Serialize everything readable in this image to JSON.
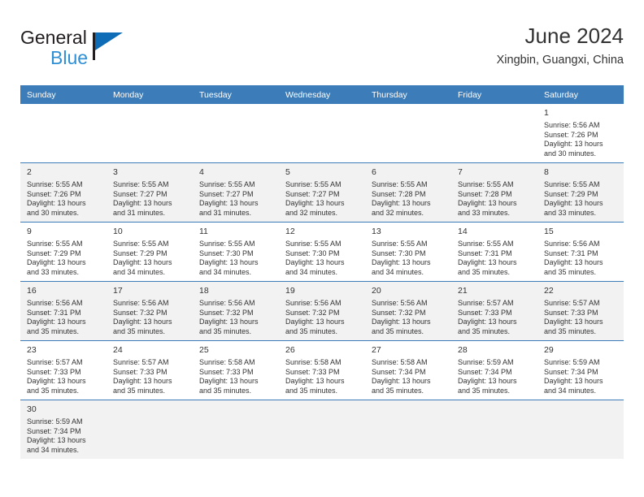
{
  "brand": {
    "name_line1": "General",
    "name_line2": "Blue",
    "primary_color": "#0f6cb6",
    "accent_color": "#2f8fd4"
  },
  "header": {
    "title": "June 2024",
    "subtitle": "Xingbin, Guangxi, China"
  },
  "calendar": {
    "header_bg": "#3b7cb9",
    "weekday_headers": [
      "Sunday",
      "Monday",
      "Tuesday",
      "Wednesday",
      "Thursday",
      "Friday",
      "Saturday"
    ],
    "labels": {
      "sunrise": "Sunrise:",
      "sunset": "Sunset:",
      "daylight": "Daylight:"
    },
    "weeks": [
      [
        {
          "day": ""
        },
        {
          "day": ""
        },
        {
          "day": ""
        },
        {
          "day": ""
        },
        {
          "day": ""
        },
        {
          "day": ""
        },
        {
          "day": "1",
          "sunrise": "Sunrise: 5:56 AM",
          "sunset": "Sunset: 7:26 PM",
          "daylight_line1": "Daylight: 13 hours",
          "daylight_line2": "and 30 minutes."
        }
      ],
      [
        {
          "day": "2",
          "sunrise": "Sunrise: 5:55 AM",
          "sunset": "Sunset: 7:26 PM",
          "daylight_line1": "Daylight: 13 hours",
          "daylight_line2": "and 30 minutes."
        },
        {
          "day": "3",
          "sunrise": "Sunrise: 5:55 AM",
          "sunset": "Sunset: 7:27 PM",
          "daylight_line1": "Daylight: 13 hours",
          "daylight_line2": "and 31 minutes."
        },
        {
          "day": "4",
          "sunrise": "Sunrise: 5:55 AM",
          "sunset": "Sunset: 7:27 PM",
          "daylight_line1": "Daylight: 13 hours",
          "daylight_line2": "and 31 minutes."
        },
        {
          "day": "5",
          "sunrise": "Sunrise: 5:55 AM",
          "sunset": "Sunset: 7:27 PM",
          "daylight_line1": "Daylight: 13 hours",
          "daylight_line2": "and 32 minutes."
        },
        {
          "day": "6",
          "sunrise": "Sunrise: 5:55 AM",
          "sunset": "Sunset: 7:28 PM",
          "daylight_line1": "Daylight: 13 hours",
          "daylight_line2": "and 32 minutes."
        },
        {
          "day": "7",
          "sunrise": "Sunrise: 5:55 AM",
          "sunset": "Sunset: 7:28 PM",
          "daylight_line1": "Daylight: 13 hours",
          "daylight_line2": "and 33 minutes."
        },
        {
          "day": "8",
          "sunrise": "Sunrise: 5:55 AM",
          "sunset": "Sunset: 7:29 PM",
          "daylight_line1": "Daylight: 13 hours",
          "daylight_line2": "and 33 minutes."
        }
      ],
      [
        {
          "day": "9",
          "sunrise": "Sunrise: 5:55 AM",
          "sunset": "Sunset: 7:29 PM",
          "daylight_line1": "Daylight: 13 hours",
          "daylight_line2": "and 33 minutes."
        },
        {
          "day": "10",
          "sunrise": "Sunrise: 5:55 AM",
          "sunset": "Sunset: 7:29 PM",
          "daylight_line1": "Daylight: 13 hours",
          "daylight_line2": "and 34 minutes."
        },
        {
          "day": "11",
          "sunrise": "Sunrise: 5:55 AM",
          "sunset": "Sunset: 7:30 PM",
          "daylight_line1": "Daylight: 13 hours",
          "daylight_line2": "and 34 minutes."
        },
        {
          "day": "12",
          "sunrise": "Sunrise: 5:55 AM",
          "sunset": "Sunset: 7:30 PM",
          "daylight_line1": "Daylight: 13 hours",
          "daylight_line2": "and 34 minutes."
        },
        {
          "day": "13",
          "sunrise": "Sunrise: 5:55 AM",
          "sunset": "Sunset: 7:30 PM",
          "daylight_line1": "Daylight: 13 hours",
          "daylight_line2": "and 34 minutes."
        },
        {
          "day": "14",
          "sunrise": "Sunrise: 5:55 AM",
          "sunset": "Sunset: 7:31 PM",
          "daylight_line1": "Daylight: 13 hours",
          "daylight_line2": "and 35 minutes."
        },
        {
          "day": "15",
          "sunrise": "Sunrise: 5:56 AM",
          "sunset": "Sunset: 7:31 PM",
          "daylight_line1": "Daylight: 13 hours",
          "daylight_line2": "and 35 minutes."
        }
      ],
      [
        {
          "day": "16",
          "sunrise": "Sunrise: 5:56 AM",
          "sunset": "Sunset: 7:31 PM",
          "daylight_line1": "Daylight: 13 hours",
          "daylight_line2": "and 35 minutes."
        },
        {
          "day": "17",
          "sunrise": "Sunrise: 5:56 AM",
          "sunset": "Sunset: 7:32 PM",
          "daylight_line1": "Daylight: 13 hours",
          "daylight_line2": "and 35 minutes."
        },
        {
          "day": "18",
          "sunrise": "Sunrise: 5:56 AM",
          "sunset": "Sunset: 7:32 PM",
          "daylight_line1": "Daylight: 13 hours",
          "daylight_line2": "and 35 minutes."
        },
        {
          "day": "19",
          "sunrise": "Sunrise: 5:56 AM",
          "sunset": "Sunset: 7:32 PM",
          "daylight_line1": "Daylight: 13 hours",
          "daylight_line2": "and 35 minutes."
        },
        {
          "day": "20",
          "sunrise": "Sunrise: 5:56 AM",
          "sunset": "Sunset: 7:32 PM",
          "daylight_line1": "Daylight: 13 hours",
          "daylight_line2": "and 35 minutes."
        },
        {
          "day": "21",
          "sunrise": "Sunrise: 5:57 AM",
          "sunset": "Sunset: 7:33 PM",
          "daylight_line1": "Daylight: 13 hours",
          "daylight_line2": "and 35 minutes."
        },
        {
          "day": "22",
          "sunrise": "Sunrise: 5:57 AM",
          "sunset": "Sunset: 7:33 PM",
          "daylight_line1": "Daylight: 13 hours",
          "daylight_line2": "and 35 minutes."
        }
      ],
      [
        {
          "day": "23",
          "sunrise": "Sunrise: 5:57 AM",
          "sunset": "Sunset: 7:33 PM",
          "daylight_line1": "Daylight: 13 hours",
          "daylight_line2": "and 35 minutes."
        },
        {
          "day": "24",
          "sunrise": "Sunrise: 5:57 AM",
          "sunset": "Sunset: 7:33 PM",
          "daylight_line1": "Daylight: 13 hours",
          "daylight_line2": "and 35 minutes."
        },
        {
          "day": "25",
          "sunrise": "Sunrise: 5:58 AM",
          "sunset": "Sunset: 7:33 PM",
          "daylight_line1": "Daylight: 13 hours",
          "daylight_line2": "and 35 minutes."
        },
        {
          "day": "26",
          "sunrise": "Sunrise: 5:58 AM",
          "sunset": "Sunset: 7:33 PM",
          "daylight_line1": "Daylight: 13 hours",
          "daylight_line2": "and 35 minutes."
        },
        {
          "day": "27",
          "sunrise": "Sunrise: 5:58 AM",
          "sunset": "Sunset: 7:34 PM",
          "daylight_line1": "Daylight: 13 hours",
          "daylight_line2": "and 35 minutes."
        },
        {
          "day": "28",
          "sunrise": "Sunrise: 5:59 AM",
          "sunset": "Sunset: 7:34 PM",
          "daylight_line1": "Daylight: 13 hours",
          "daylight_line2": "and 35 minutes."
        },
        {
          "day": "29",
          "sunrise": "Sunrise: 5:59 AM",
          "sunset": "Sunset: 7:34 PM",
          "daylight_line1": "Daylight: 13 hours",
          "daylight_line2": "and 34 minutes."
        }
      ],
      [
        {
          "day": "30",
          "sunrise": "Sunrise: 5:59 AM",
          "sunset": "Sunset: 7:34 PM",
          "daylight_line1": "Daylight: 13 hours",
          "daylight_line2": "and 34 minutes."
        },
        {
          "day": ""
        },
        {
          "day": ""
        },
        {
          "day": ""
        },
        {
          "day": ""
        },
        {
          "day": ""
        },
        {
          "day": ""
        }
      ]
    ]
  }
}
